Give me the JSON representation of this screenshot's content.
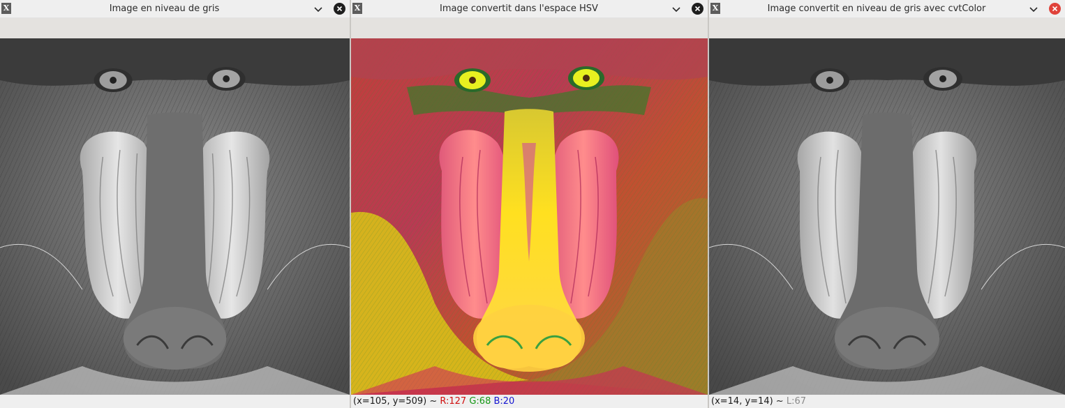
{
  "windows": [
    {
      "title": "Image en niveau de gris",
      "status": null,
      "close_style": "dark"
    },
    {
      "title": "Image convertit dans l'espace HSV",
      "status": {
        "coords": "(x=105, y=509) ~ ",
        "r": "R:127",
        "g": "G:68",
        "b": "B:20"
      },
      "close_style": "dark"
    },
    {
      "title": "Image convertit en niveau de gris avec cvtColor",
      "status": {
        "coords": "(x=14, y=14) ~ ",
        "l": "L:67"
      },
      "close_style": "red"
    }
  ],
  "image_content": [
    "mandrill-grayscale",
    "mandrill-hsv-false-color",
    "mandrill-grayscale"
  ],
  "icons": [
    "app-icon",
    "chevron-down-icon",
    "close-icon"
  ],
  "colors": {
    "close_dark": "#1e1e1e",
    "close_active": "#e0423a",
    "status_r": "#d01010",
    "status_g": "#149814",
    "status_b": "#1414d0",
    "status_l": "#8a8a8a"
  }
}
